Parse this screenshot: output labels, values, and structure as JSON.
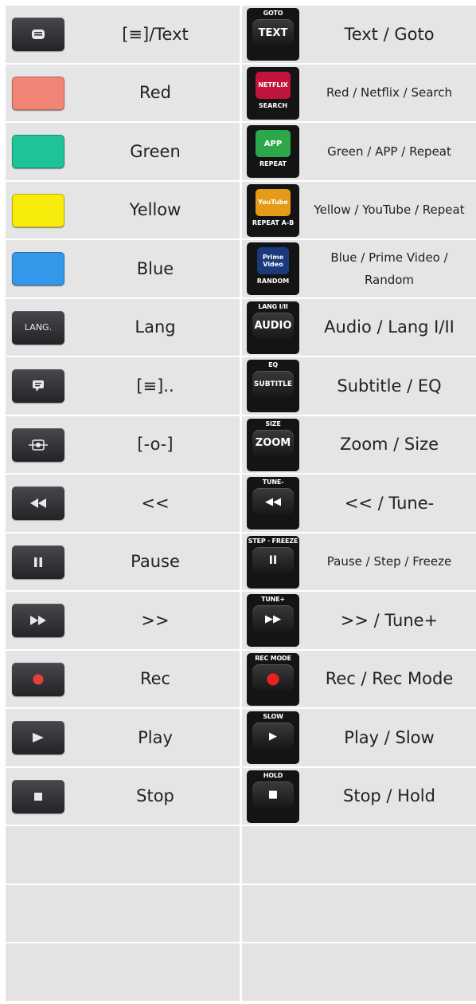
{
  "rows": [
    {
      "left_label": "[≡]/Text",
      "left_icon": "text-menu-icon",
      "right_top": "GOTO",
      "right_key": "TEXT",
      "right_bottom": "",
      "right_label": "Text / Goto",
      "small": false
    },
    {
      "left_label": "Red",
      "left_icon": "red-color-key",
      "left_color": "#f28476",
      "right_top": "",
      "right_key": "NETFLIX",
      "right_bottom": "SEARCH",
      "right_keycolor": "#c0143c",
      "right_label": "Red / Netflix / Search",
      "small": true
    },
    {
      "left_label": "Green",
      "left_icon": "green-color-key",
      "left_color": "#1fc39a",
      "right_top": "",
      "right_key": "APP",
      "right_bottom": "REPEAT",
      "right_keycolor": "#2ca84a",
      "right_label": "Green / APP / Repeat",
      "small": true
    },
    {
      "left_label": "Yellow",
      "left_icon": "yellow-color-key",
      "left_color": "#f8ec0c",
      "right_top": "",
      "right_key": "YouTube",
      "right_bottom": "REPEAT A-B",
      "right_keycolor": "#e59a18",
      "right_label": "Yellow / YouTube / Repeat",
      "small": true
    },
    {
      "left_label": "Blue",
      "left_icon": "blue-color-key",
      "left_color": "#3397ea",
      "right_top": "",
      "right_key": "Prime Video",
      "right_bottom": "RANDOM",
      "right_keycolor": "#1a3a7c",
      "right_label": "Blue / Prime Video / Random",
      "small": true
    },
    {
      "left_label": "Lang",
      "left_icon": "lang-key",
      "left_text": "LANG.",
      "right_top": "LANG I/II",
      "right_key": "AUDIO",
      "right_bottom": "",
      "right_label": "Audio / Lang I/II",
      "small": false
    },
    {
      "left_label": "[≡]..",
      "left_icon": "subtitle-icon",
      "right_top": "EQ",
      "right_key": "SUBTITLE",
      "right_bottom": "",
      "right_label": "Subtitle / EQ",
      "small": false
    },
    {
      "left_label": "[-o-]",
      "left_icon": "zoom-icon",
      "right_top": "SIZE",
      "right_key": "ZOOM",
      "right_bottom": "",
      "right_label": "Zoom / Size",
      "small": false
    },
    {
      "left_label": "<<",
      "left_icon": "rewind-icon",
      "right_top": "TUNE-",
      "right_key": "◀◀",
      "right_bottom": "",
      "right_label": "<< / Tune-",
      "small": false
    },
    {
      "left_label": "Pause",
      "left_icon": "pause-icon",
      "right_top": "STEP · FREEZE",
      "right_key": "II",
      "right_bottom": "",
      "right_label": "Pause / Step / Freeze",
      "small": true
    },
    {
      "left_label": ">>",
      "left_icon": "fast-forward-icon",
      "right_top": "TUNE+",
      "right_key": "▶▶",
      "right_bottom": "",
      "right_label": ">> / Tune+",
      "small": false
    },
    {
      "left_label": "Rec",
      "left_icon": "record-icon",
      "right_top": "REC MODE",
      "right_key": "●",
      "right_bottom": "",
      "right_label": "Rec / Rec Mode",
      "small": false
    },
    {
      "left_label": "Play",
      "left_icon": "play-icon",
      "right_top": "SLOW",
      "right_key": "▶",
      "right_bottom": "",
      "right_label": "Play / Slow",
      "small": false
    },
    {
      "left_label": "Stop",
      "left_icon": "stop-icon",
      "right_top": "HOLD",
      "right_key": "■",
      "right_bottom": "",
      "right_label": "Stop / Hold",
      "small": false
    }
  ],
  "empty_rows": 3
}
